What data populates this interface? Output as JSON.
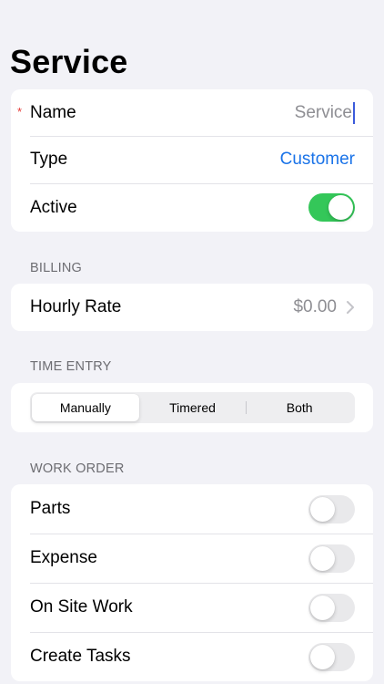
{
  "page": {
    "title": "Service"
  },
  "general": {
    "name": {
      "label": "Name",
      "required_mark": "*",
      "placeholder": "Service",
      "value": ""
    },
    "type": {
      "label": "Type",
      "value": "Customer"
    },
    "active": {
      "label": "Active",
      "on": true
    }
  },
  "billing": {
    "header": "BILLING",
    "hourly_rate": {
      "label": "Hourly Rate",
      "value": "$0.00"
    }
  },
  "time_entry": {
    "header": "TIME ENTRY",
    "options": [
      "Manually",
      "Timered",
      "Both"
    ],
    "selected": "Manually"
  },
  "work_order": {
    "header": "WORK ORDER",
    "items": [
      {
        "label": "Parts",
        "on": false
      },
      {
        "label": "Expense",
        "on": false
      },
      {
        "label": "On Site Work",
        "on": false
      },
      {
        "label": "Create Tasks",
        "on": false
      }
    ]
  },
  "colors": {
    "accent": "#1a73e8",
    "toggle_on": "#34c759",
    "toggle_off": "#e9e9eb",
    "required": "#e53935",
    "background": "#f2f2f7"
  }
}
